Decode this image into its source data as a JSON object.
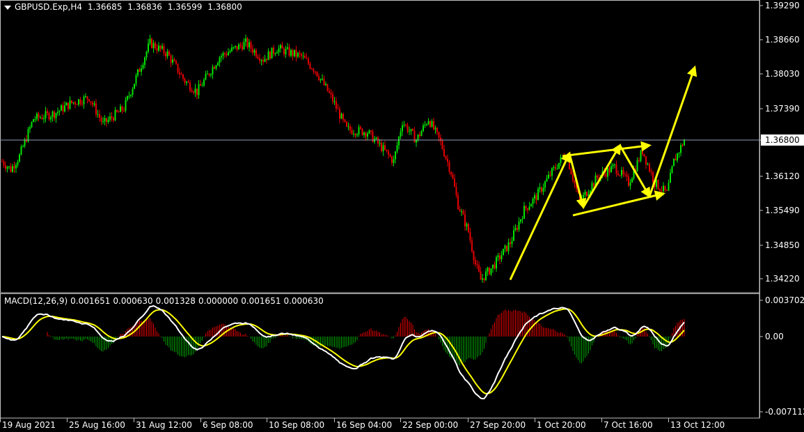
{
  "header": {
    "symbol": "GBPUSD.Exp,H4",
    "open": "1.36685",
    "high": "1.36836",
    "low": "1.36599",
    "close": "1.36800"
  },
  "macd_header": {
    "name": "MACD(12,26,9)",
    "values": [
      "0.001651",
      "0.000630",
      "0.001328",
      "0.000000",
      "0.001651",
      "0.000630"
    ]
  },
  "current_price_label": "1.36800",
  "colors": {
    "background": "#000000",
    "bull": "#00e600",
    "bear": "#e60000",
    "macd_line": "#ffffff",
    "signal_line": "#ffff00",
    "hist_pos": "#e60000",
    "hist_neg": "#00a000",
    "arrows": "#ffff00",
    "grid_frame": "#c0c0c0"
  },
  "chart_data": [
    {
      "type": "candlestick",
      "y_tick_labels": [
        "1.39290",
        "1.38660",
        "1.38030",
        "1.37390",
        "1.36800",
        "1.36120",
        "1.35490",
        "1.34850",
        "1.34220"
      ],
      "x_tick_labels": [
        "19 Aug 2021",
        "25 Aug 16:00",
        "31 Aug 12:00",
        "6 Sep 08:00",
        "10 Sep 08:00",
        "16 Sep 04:00",
        "22 Sep 00:00",
        "27 Sep 20:00",
        "1 Oct 20:00",
        "7 Oct 16:00",
        "13 Oct 12:00"
      ],
      "ylim": [
        1.341,
        1.3935
      ],
      "current_price": 1.368,
      "price_path": [
        [
          0,
          1.364
        ],
        [
          5,
          1.3625
        ],
        [
          10,
          1.365
        ],
        [
          18,
          1.372
        ],
        [
          30,
          1.373
        ],
        [
          40,
          1.375
        ],
        [
          50,
          1.376
        ],
        [
          58,
          1.371
        ],
        [
          70,
          1.374
        ],
        [
          85,
          1.386
        ],
        [
          95,
          1.384
        ],
        [
          105,
          1.379
        ],
        [
          112,
          1.377
        ],
        [
          125,
          1.3835
        ],
        [
          140,
          1.386
        ],
        [
          150,
          1.383
        ],
        [
          158,
          1.385
        ],
        [
          172,
          1.3835
        ],
        [
          180,
          1.381
        ],
        [
          190,
          1.3755
        ],
        [
          198,
          1.37
        ],
        [
          210,
          1.3695
        ],
        [
          217,
          1.367
        ],
        [
          225,
          1.364
        ],
        [
          230,
          1.3715
        ],
        [
          238,
          1.368
        ],
        [
          245,
          1.372
        ],
        [
          252,
          1.3675
        ],
        [
          258,
          1.362
        ],
        [
          262,
          1.356
        ],
        [
          268,
          1.351
        ],
        [
          272,
          1.345
        ],
        [
          275,
          1.342
        ],
        [
          282,
          1.3445
        ],
        [
          292,
          1.349
        ],
        [
          300,
          1.355
        ],
        [
          307,
          1.3575
        ],
        [
          316,
          1.362
        ],
        [
          324,
          1.3655
        ],
        [
          332,
          1.3565
        ],
        [
          342,
          1.361
        ],
        [
          352,
          1.363
        ],
        [
          360,
          1.36
        ],
        [
          368,
          1.366
        ],
        [
          375,
          1.36
        ],
        [
          382,
          1.358
        ],
        [
          386,
          1.364
        ],
        [
          392,
          1.368
        ]
      ],
      "annotations": {
        "type": "arrows",
        "arrows": [
          {
            "from": [
              292,
              1.342
            ],
            "to": [
              326,
              1.3655
            ]
          },
          {
            "from": [
              326,
              1.3655
            ],
            "to": [
              334,
              1.3555
            ]
          },
          {
            "from": [
              334,
              1.3555
            ],
            "to": [
              355,
              1.367
            ]
          },
          {
            "from": [
              355,
              1.367
            ],
            "to": [
              372,
              1.3575
            ]
          },
          {
            "from": [
              372,
              1.3575
            ],
            "to": [
              398,
              1.3815
            ]
          },
          {
            "from": [
              322,
              1.365
            ],
            "to": [
              372,
              1.367
            ]
          },
          {
            "from": [
              328,
              1.354
            ],
            "to": [
              380,
              1.358
            ]
          }
        ]
      }
    },
    {
      "type": "macd",
      "title": "MACD(12,26,9)",
      "y_tick_labels": [
        "0.003702",
        "0.00",
        "-0.007112"
      ],
      "ylim": [
        -0.0075,
        0.004
      ]
    }
  ]
}
